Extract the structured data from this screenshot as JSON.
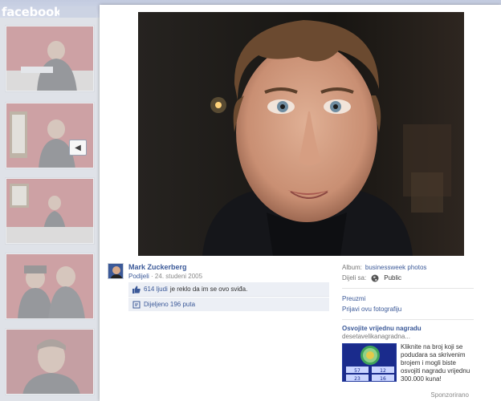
{
  "header": {
    "logo": "facebook"
  },
  "rail": {
    "thumbnails": [
      "thumbnail-1",
      "thumbnail-2",
      "thumbnail-3",
      "thumbnail-4",
      "thumbnail-5"
    ],
    "arrow_icon": "triangle-left"
  },
  "photo": {
    "owner": "Mark Zuckerberg",
    "shared_label": "Podijeli",
    "date": "24. studeni 2005",
    "likes_count": "614 ljudi",
    "likes_text": "je reklo da im se ovo sviđa.",
    "shares_text": "Dijeljeno 196 puta"
  },
  "side": {
    "album_label": "Album:",
    "album_name": "businessweek photos",
    "share_label": "Dijeli sa:",
    "share_value": "Public",
    "download": "Preuzmi",
    "report": "Prijavi ovu fotografiju"
  },
  "ad": {
    "title": "Osvojite vrijednu nagradu",
    "domain": "desetavelikanagradna...",
    "text": "Kliknite na broj koji se podudara sa skrivenim brojem i mogli biste osvojiti nagradu vrijednu 300.000 kuna!",
    "numbers": [
      "57",
      "12",
      "23",
      "16"
    ],
    "sponsored": "Sponzorirano"
  },
  "colors": {
    "brand": "#3b5998",
    "topbar": "#c3cbe0",
    "ad_bg": "#1a2b8c"
  }
}
